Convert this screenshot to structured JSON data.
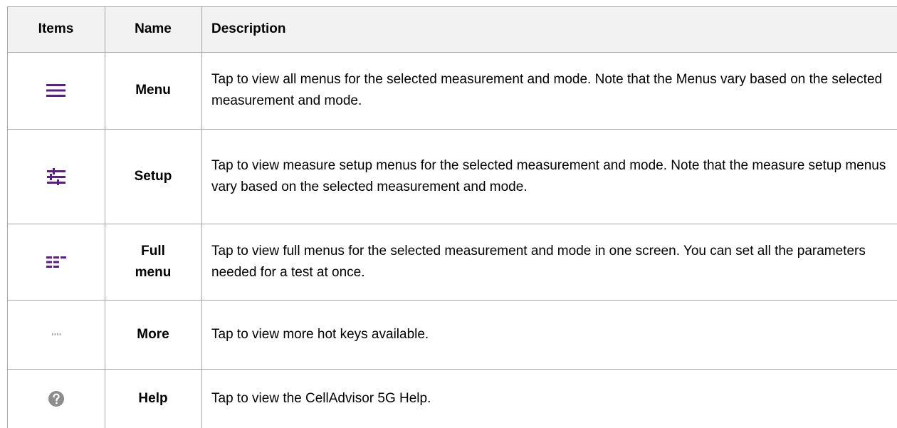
{
  "table": {
    "headers": {
      "items": "Items",
      "name": "Name",
      "description": "Description"
    },
    "rows": [
      {
        "icon": "hamburger-menu-icon",
        "name": "Menu",
        "description": "Tap to view all menus for the selected measurement and mode. Note that the Menus vary based on the selected measurement and mode."
      },
      {
        "icon": "setup-sliders-icon",
        "name": "Setup",
        "description": "Tap to view measure setup menus for the selected measurement and mode. Note that the measure setup menus vary based on the selected measurement and mode."
      },
      {
        "icon": "full-menu-icon",
        "name_line1": "Full",
        "name_line2": "menu",
        "description": "Tap to view full menus for the selected measurement and mode in one screen. You can set all the parameters needed for a test at once."
      },
      {
        "icon": "more-dots-icon",
        "name": "More",
        "description": "Tap to view more hot keys available."
      },
      {
        "icon": "help-question-icon",
        "name": "Help",
        "description": "Tap to view the CellAdvisor 5G Help."
      }
    ]
  },
  "colors": {
    "icon_purple": "#5b1c8c",
    "icon_gray": "#8c8c8c",
    "border": "#a6a6a6",
    "header_bg": "#f2f2f2"
  }
}
